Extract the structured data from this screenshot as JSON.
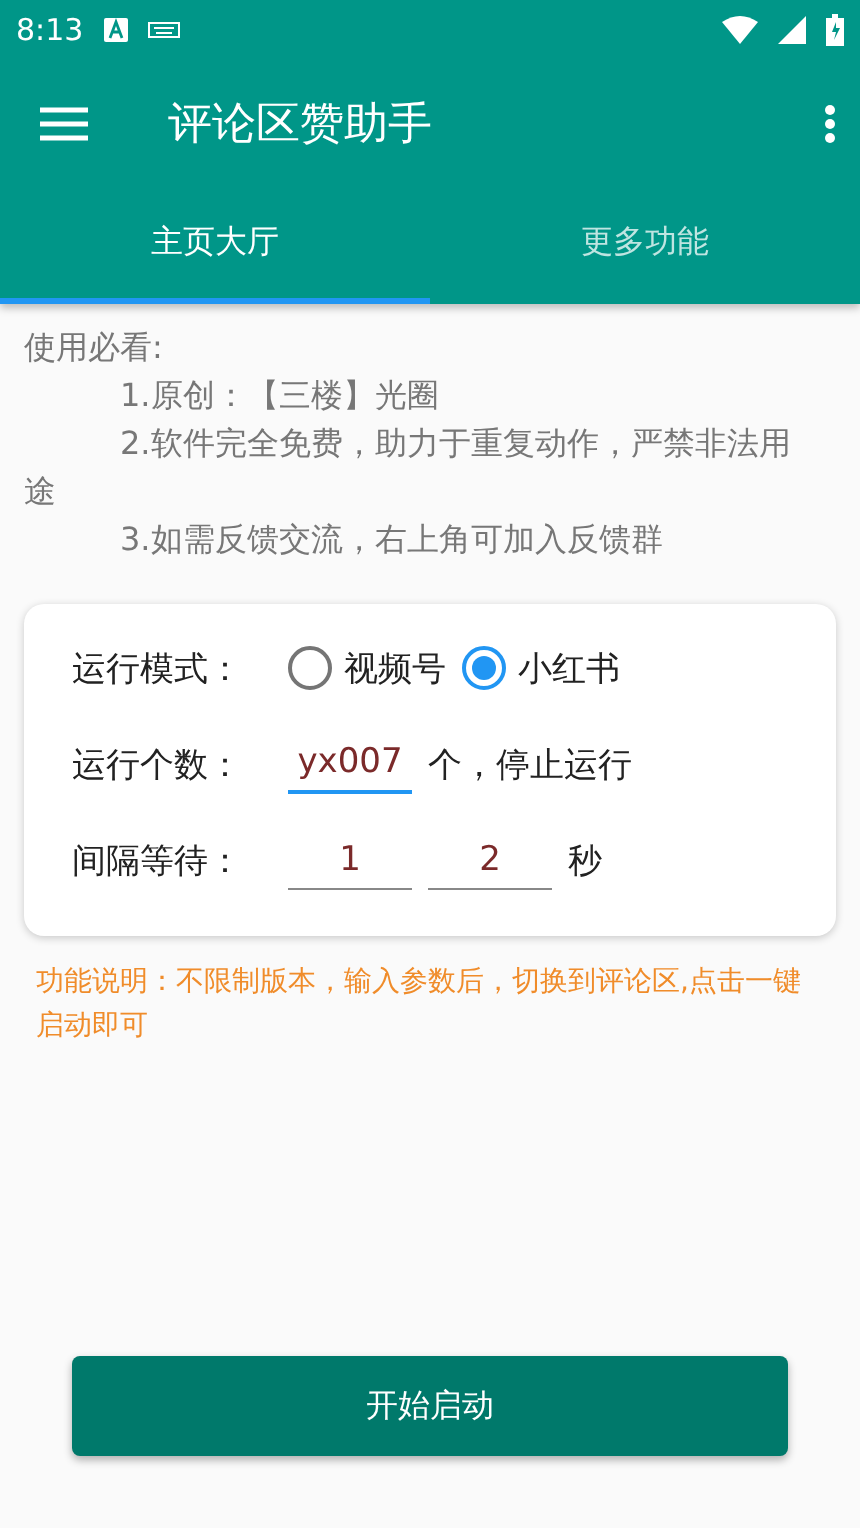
{
  "status_bar": {
    "time": "8:13"
  },
  "toolbar": {
    "title": "评论区赞助手"
  },
  "tabs": [
    {
      "label": "主页大厅",
      "selected": true
    },
    {
      "label": "更多功能",
      "selected": false
    }
  ],
  "notes": {
    "heading": "使用必看:",
    "items": [
      "1.原创：【三楼】光圈",
      "2.软件完全免费，助力于重复动作，严禁非法用途",
      "3.如需反馈交流，右上角可加入反馈群"
    ]
  },
  "form": {
    "mode": {
      "label": "运行模式：",
      "options": [
        {
          "label": "视频号",
          "selected": false
        },
        {
          "label": "小红书",
          "selected": true
        }
      ]
    },
    "count": {
      "label": "运行个数：",
      "value": "yx007",
      "focused": true,
      "suffix": "个，停止运行"
    },
    "interval": {
      "label": "间隔等待：",
      "fields": [
        {
          "value": "1",
          "focused": false
        },
        {
          "value": "2",
          "focused": false
        }
      ],
      "suffix": "秒"
    }
  },
  "description": "功能说明：不限制版本，输入参数后，切换到评论区,点击一键启动即可",
  "start_button": "开始启动"
}
